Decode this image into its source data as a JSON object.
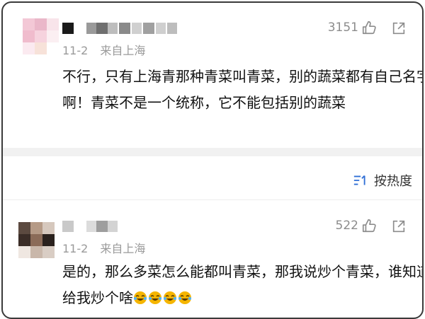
{
  "comments": [
    {
      "date": "11-2",
      "location": "来自上海",
      "likes": "3151",
      "text": "不行，只有上海青那种青菜叫青菜，别的蔬菜都有自己名字啊！青菜不是一个统称，它不能包括别的蔬菜"
    },
    {
      "date": "11-2",
      "location": "来自上海",
      "likes": "522",
      "text": "是的，那么多菜怎么能都叫青菜，那我说炒个青菜，谁知道给我炒个啥"
    }
  ],
  "sort": {
    "label": "按热度"
  },
  "icons": {
    "like": "thumbs-up-icon",
    "share": "share-icon",
    "sort": "sort-icon",
    "emoji": "laugh-cry-icon"
  },
  "colors": {
    "text": "#111111",
    "meta": "#9a9a9a",
    "emoji": "#f5b500"
  }
}
